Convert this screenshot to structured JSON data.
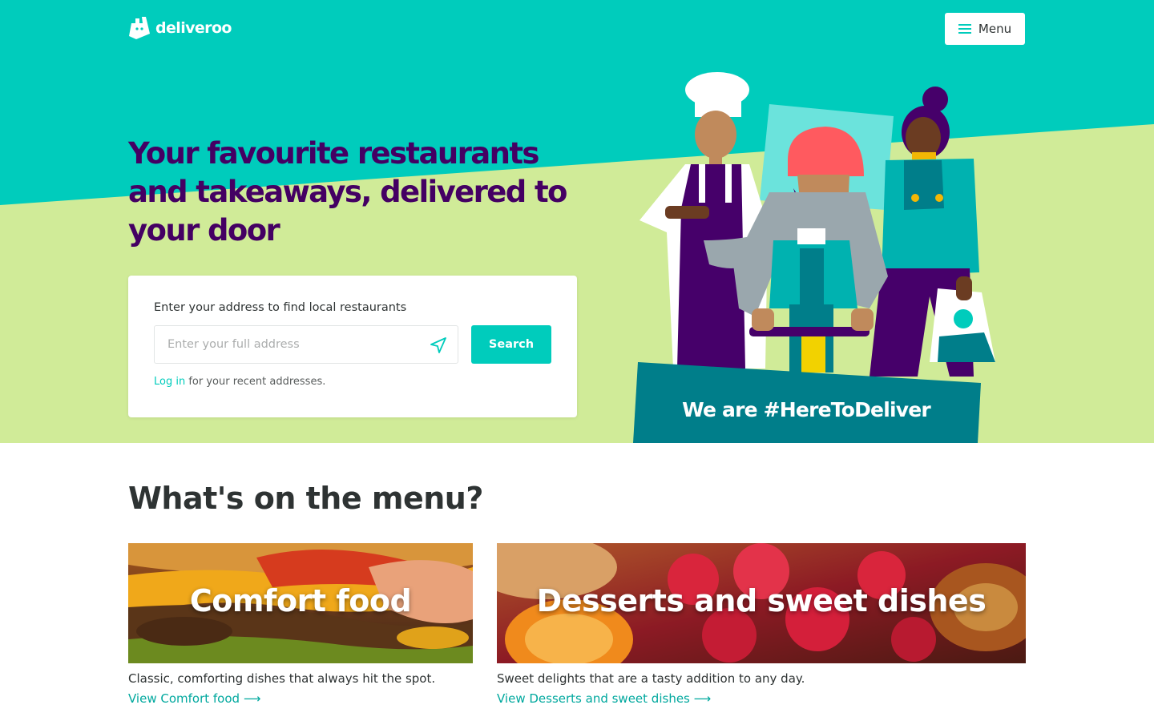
{
  "header": {
    "logo_text": "deliveroo",
    "menu_label": "Menu"
  },
  "hero": {
    "title": "Your favourite restaurants and takeaways, delivered to your door",
    "banner_text": "We are #HereToDeliver"
  },
  "search": {
    "label": "Enter your address to find local restaurants",
    "placeholder": "Enter your full address",
    "value": "",
    "button_label": "Search",
    "login_link": "Log in",
    "login_suffix": " for your recent addresses."
  },
  "menu_section": {
    "title": "What's on the menu?",
    "cards": [
      {
        "image_title": "Comfort food",
        "description": "Classic, comforting dishes that always hit the spot.",
        "link": "View Comfort food ⟶"
      },
      {
        "image_title": "Desserts and sweet dishes",
        "description": "Sweet delights that are a tasty addition to any day.",
        "link": "View Desserts and sweet dishes ⟶"
      }
    ]
  },
  "colors": {
    "brand_teal": "#00ccbc",
    "hero_lime": "#d0eb98",
    "title_purple": "#440063",
    "banner_dark_teal": "#007e8a"
  },
  "icons": [
    "deliveroo-logo-icon",
    "hamburger-icon",
    "locate-arrow-icon"
  ]
}
